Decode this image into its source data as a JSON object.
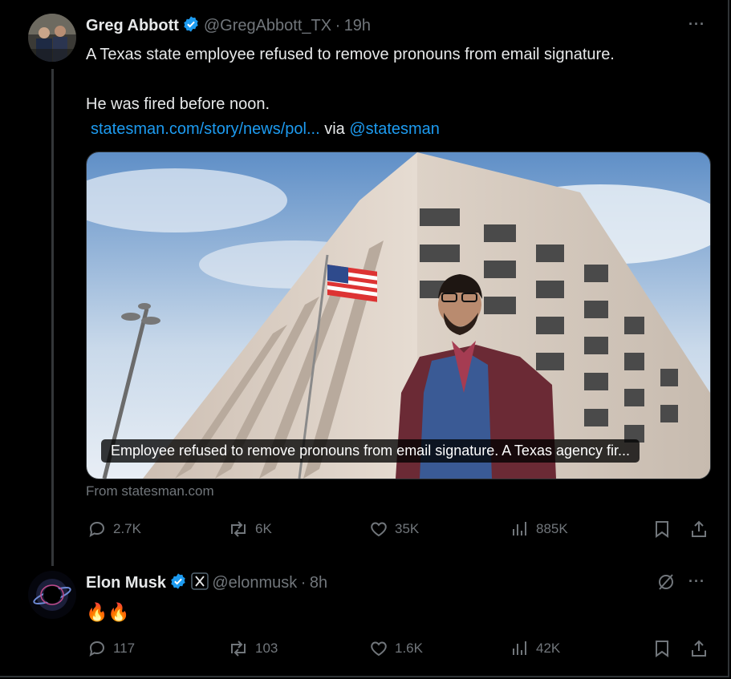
{
  "tweet1": {
    "author_name": "Greg Abbott",
    "handle": "@GregAbbott_TX",
    "sep": "·",
    "time": "19h",
    "line1": "A Texas state employee refused to remove pronouns from email signature.",
    "line2": "He was fired before noon.",
    "link_text": "statesman.com/story/news/pol...",
    "via": " via ",
    "via_handle": "@statesman",
    "card_caption": "Employee refused to remove pronouns from email signature. A Texas agency fir...",
    "card_source": "From statesman.com",
    "replies": "2.7K",
    "reposts": "6K",
    "likes": "35K",
    "views": "885K"
  },
  "tweet2": {
    "author_name": "Elon Musk",
    "handle": "@elonmusk",
    "sep": "·",
    "time": "8h",
    "text": "🔥🔥",
    "replies": "117",
    "reposts": "103",
    "likes": "1.6K",
    "views": "42K"
  },
  "icons": {
    "reply": "reply-icon",
    "repost": "repost-icon",
    "like": "heart-icon",
    "views": "views-icon",
    "bookmark": "bookmark-icon",
    "share": "share-icon",
    "more": "more-icon",
    "verified": "verified-badge-icon",
    "grok": "grok-icon",
    "affiliate": "x-logo-icon"
  },
  "colors": {
    "background": "#000000",
    "text": "#e7e9ea",
    "secondary": "#71767b",
    "link": "#1d9bf0",
    "verified": "#1d9bf0"
  }
}
